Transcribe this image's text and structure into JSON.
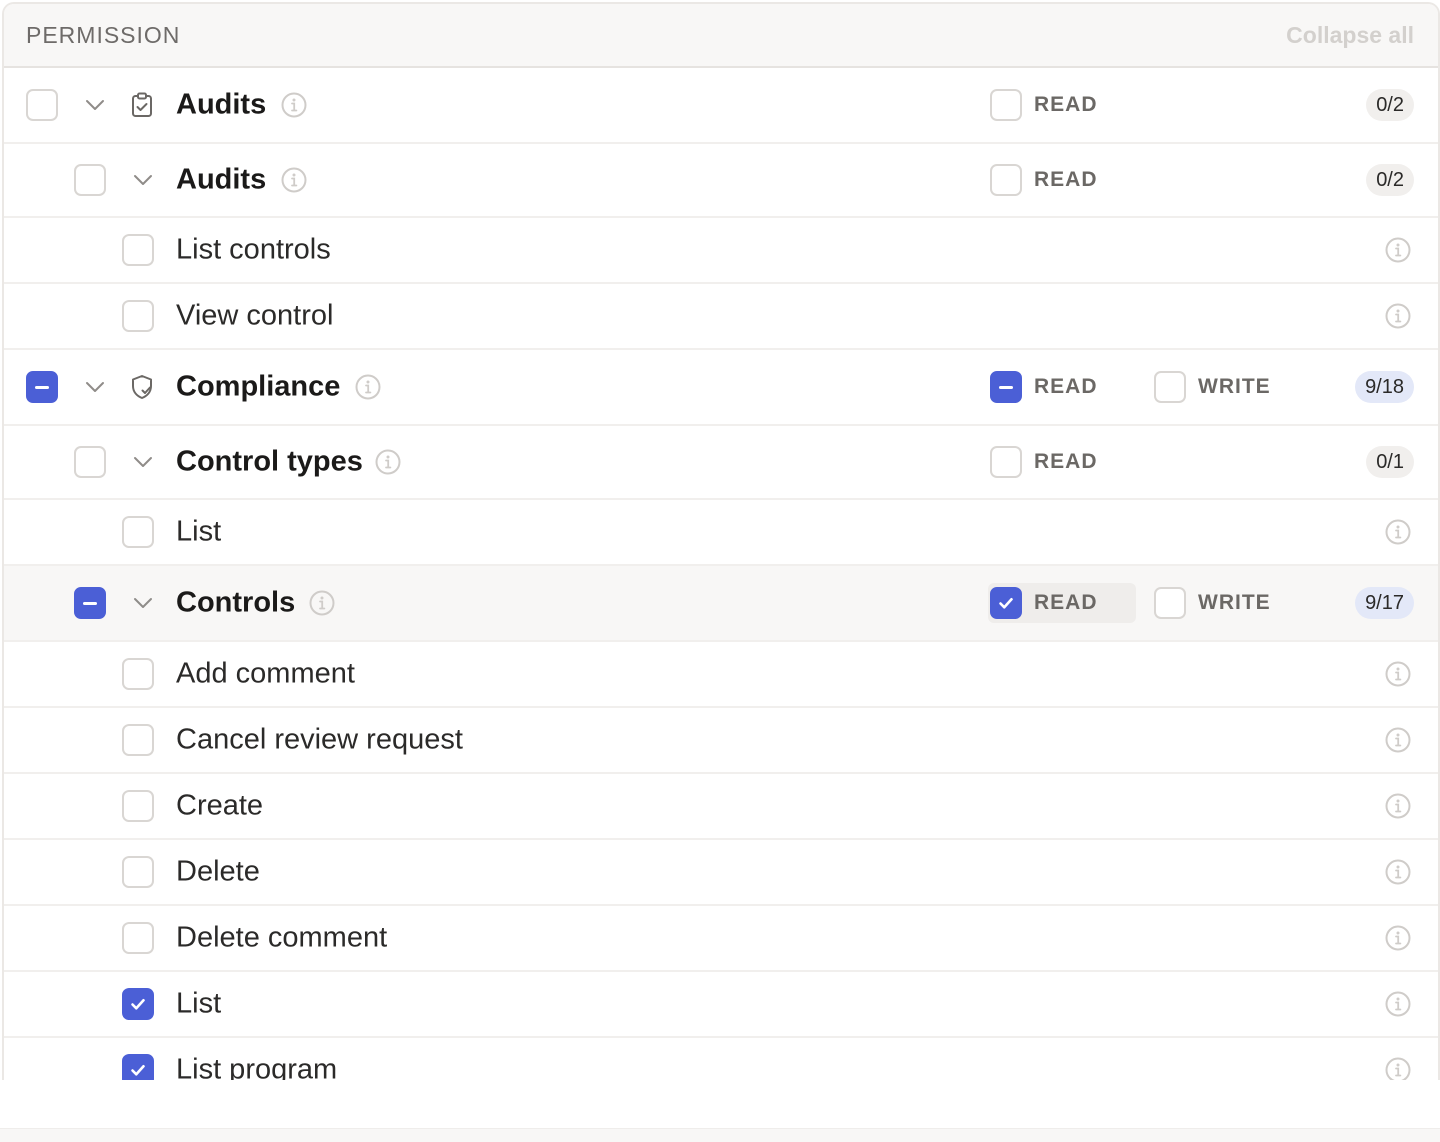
{
  "header": {
    "title": "PERMISSION",
    "collapse_label": "Collapse all"
  },
  "colors": {
    "accent": "#4b5fd6",
    "badge_blue": "#e3e8f8",
    "badge_gray": "#f1efed"
  },
  "rows": [
    {
      "label": "Audits",
      "icon": "clipboard-check-icon",
      "read_label": "READ",
      "count": "0/2"
    },
    {
      "label": "Audits",
      "read_label": "READ",
      "count": "0/2"
    },
    {
      "label": "List controls"
    },
    {
      "label": "View control"
    },
    {
      "label": "Compliance",
      "icon": "shield-check-icon",
      "read_label": "READ",
      "write_label": "WRITE",
      "count": "9/18"
    },
    {
      "label": "Control types",
      "read_label": "READ",
      "count": "0/1"
    },
    {
      "label": "List"
    },
    {
      "label": "Controls",
      "read_label": "READ",
      "write_label": "WRITE",
      "count": "9/17"
    },
    {
      "label": "Add comment"
    },
    {
      "label": "Cancel review request"
    },
    {
      "label": "Create"
    },
    {
      "label": "Delete"
    },
    {
      "label": "Delete comment"
    },
    {
      "label": "List",
      "checked": true
    },
    {
      "label": "List program",
      "checked": true
    }
  ]
}
